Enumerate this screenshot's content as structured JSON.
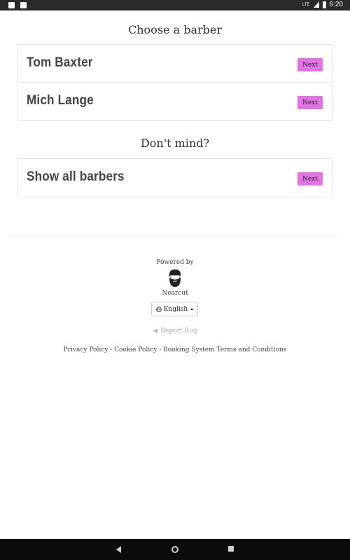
{
  "status_bar": {
    "network_label": "LTE",
    "time": "6:20"
  },
  "headings": {
    "choose": "Choose a barber",
    "dont_mind": "Don't mind?"
  },
  "barbers": [
    {
      "name": "Tom Baxter",
      "button": "Next"
    },
    {
      "name": "Mich Lange",
      "button": "Next"
    }
  ],
  "show_all": {
    "name": "Show all barbers",
    "button": "Next"
  },
  "footer": {
    "powered_by": "Powered by",
    "brand": "Nearcut",
    "language": "English",
    "report_bug": "Report Bug",
    "links": "Privacy Policy - Cookie Policy - Booking System Terms and Conditions"
  },
  "colors": {
    "accent": "#e173e5",
    "nav_bar": "#0b0b0b",
    "status_bar": "#2a2a2a"
  }
}
